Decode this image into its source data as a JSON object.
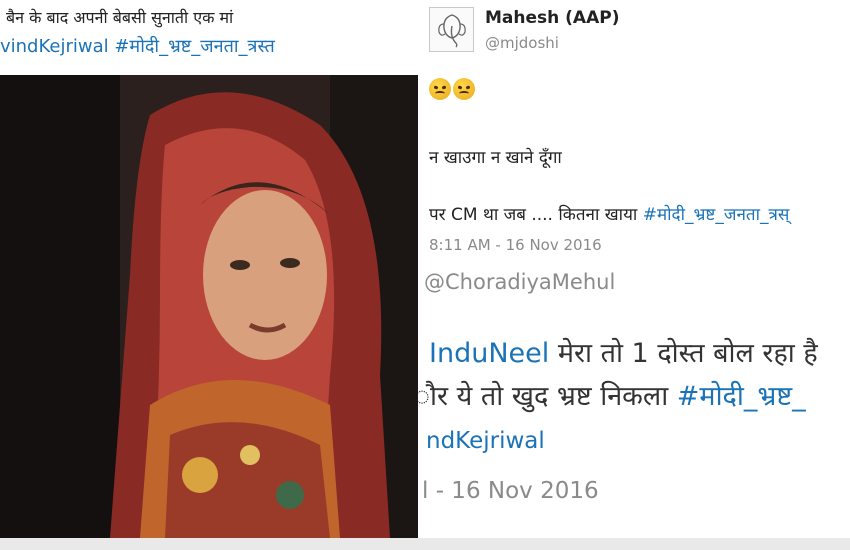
{
  "left_panel": {
    "caption_line1": "बैन के बाद अपनी बेबसी सुनाती एक मां",
    "caption_line2": "vindKejriwal #मोदी_भ्रष्ट_जनता_त्रस्त"
  },
  "tweet": {
    "author_name": "Mahesh (AAP)",
    "author_handle": "@mjdoshi",
    "emoji": "😠😠",
    "line1": "न खाउगा न खाने दूँगा",
    "line2_text": "पर CM था जब .... कितना खाया ",
    "line2_hashtag": "#मोदी_भ्रष्ट_जनता_त्रस्",
    "timestamp": "8:11 AM - 16 Nov 2016"
  },
  "reply": {
    "mention": "@ChoradiyaMehul",
    "line1_handle": "InduNeel",
    "line1_text": " मेरा तो 1 दोस्त बोल रहा है",
    "line2_text": "ौर ये तो खुद भ्रष्ट निकला ",
    "line2_hashtag": "#मोदी_भ्रष्ट_",
    "line3": "ndKejriwal",
    "timestamp": "l - 16 Nov 2016"
  },
  "colors": {
    "hashtag": "#1b73b7",
    "muted": "#8a8a8a",
    "text": "#222222"
  }
}
